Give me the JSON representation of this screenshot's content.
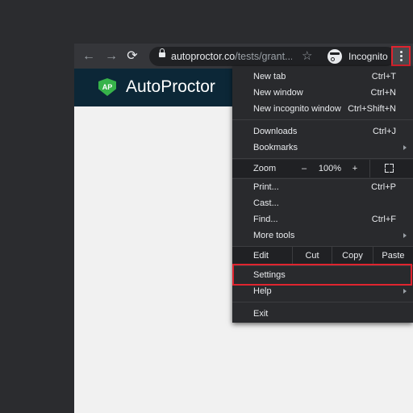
{
  "browser": {
    "url_host": "autoproctor.co",
    "url_path": "/tests/grant...",
    "incognito_label": "Incognito"
  },
  "site": {
    "logo_mark": "AP",
    "logo_text": "AutoProctor"
  },
  "menu": {
    "group1": [
      {
        "label": "New tab",
        "shortcut": "Ctrl+T"
      },
      {
        "label": "New window",
        "shortcut": "Ctrl+N"
      },
      {
        "label": "New incognito window",
        "shortcut": "Ctrl+Shift+N"
      }
    ],
    "group2": [
      {
        "label": "Downloads",
        "shortcut": "Ctrl+J"
      },
      {
        "label": "Bookmarks"
      }
    ],
    "zoom": {
      "label": "Zoom",
      "minus": "–",
      "value": "100%",
      "plus": "+"
    },
    "group3": [
      {
        "label": "Print...",
        "shortcut": "Ctrl+P"
      },
      {
        "label": "Cast..."
      },
      {
        "label": "Find...",
        "shortcut": "Ctrl+F"
      },
      {
        "label": "More tools"
      }
    ],
    "edit": {
      "label": "Edit",
      "cut": "Cut",
      "copy": "Copy",
      "paste": "Paste"
    },
    "group4": [
      {
        "label": "Settings"
      },
      {
        "label": "Help"
      }
    ],
    "exit": "Exit"
  }
}
